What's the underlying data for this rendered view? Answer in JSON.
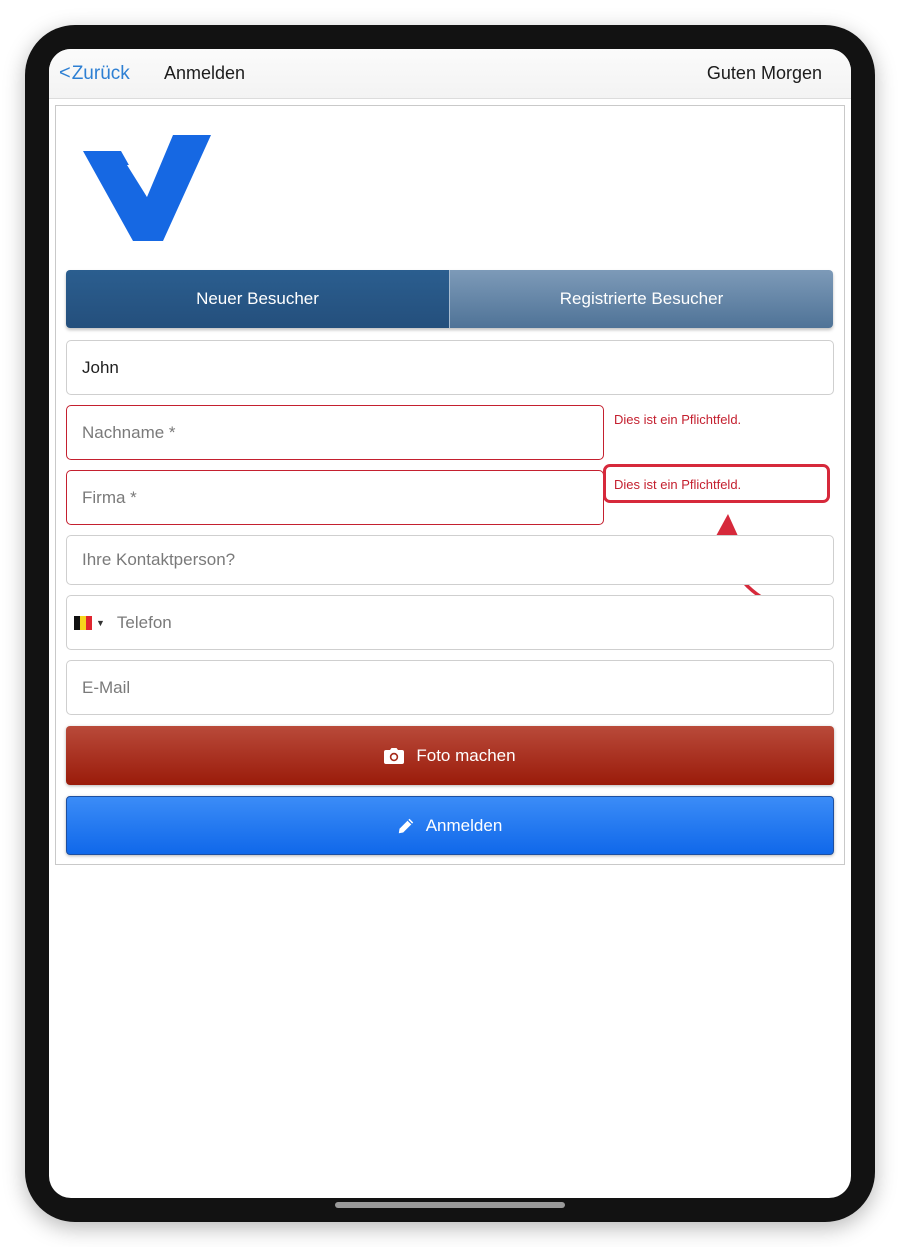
{
  "navbar": {
    "back_label": "Zurück",
    "title": "Anmelden",
    "greeting": "Guten Morgen"
  },
  "logo": {
    "icon": "checkmark-v-logo",
    "color": "#1668e3"
  },
  "tabs": [
    {
      "label": "Neuer Besucher",
      "active": true
    },
    {
      "label": "Registrierte Besucher",
      "active": false
    }
  ],
  "form": {
    "first_name": {
      "value": "John"
    },
    "last_name": {
      "placeholder": "Nachname *",
      "error": "Dies ist ein Pflichtfeld."
    },
    "company": {
      "placeholder": "Firma *",
      "error": "Dies ist ein Pflichtfeld."
    },
    "contact_person": {
      "placeholder": "Ihre Kontaktperson?"
    },
    "phone": {
      "placeholder": "Telefon",
      "country_flag": "belgium-flag-icon"
    },
    "email": {
      "placeholder": "E-Mail"
    }
  },
  "buttons": {
    "photo": {
      "label": "Foto machen",
      "icon": "camera-icon"
    },
    "login": {
      "label": "Anmelden",
      "icon": "pencil-icon"
    }
  },
  "colors": {
    "accent": "#2d7fd3",
    "error": "#c4202f",
    "tab_active": "#244f7c",
    "photo_button": "#9a1b0a",
    "login_button": "#1068ea"
  }
}
